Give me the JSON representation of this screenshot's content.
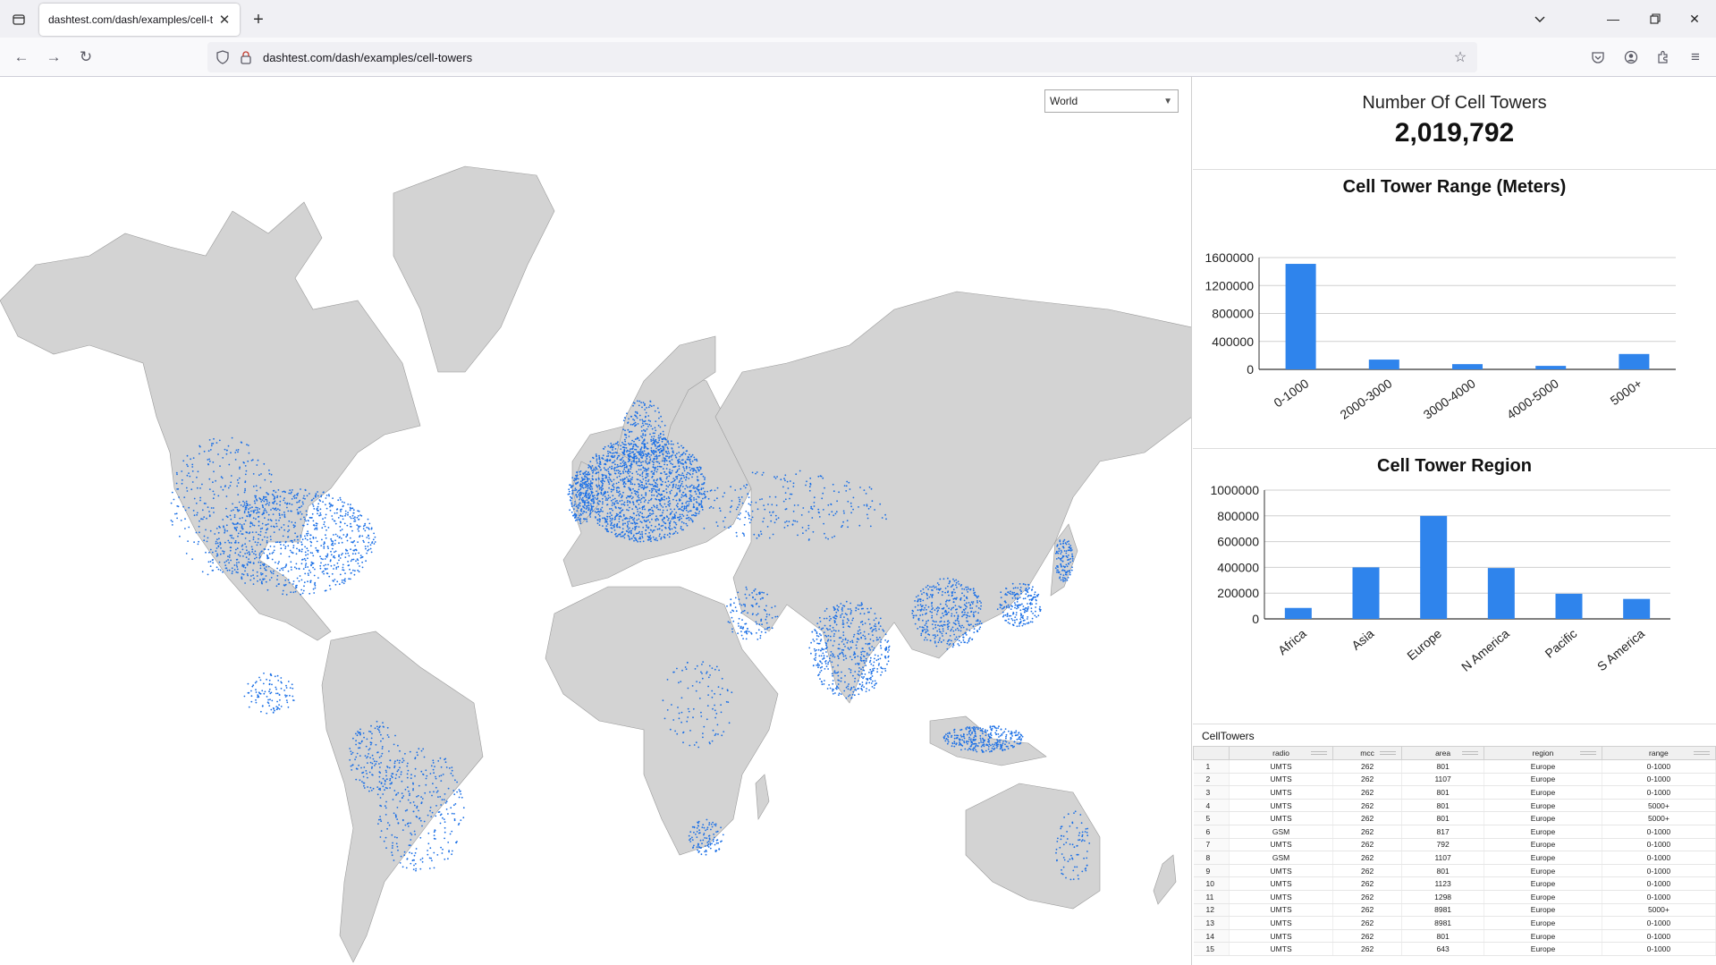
{
  "browser": {
    "tab_title": "dashtest.com/dash/examples/cell-t",
    "url": "dashtest.com/dash/examples/cell-towers"
  },
  "map": {
    "region_select": {
      "value": "World"
    },
    "land_color": "#d3d3d3",
    "tower_color": "#1a6fe6"
  },
  "summary": {
    "title": "Number Of Cell Towers",
    "value": "2,019,792"
  },
  "charts": [
    {
      "type": "bar",
      "title": "Cell Tower Range (Meters)",
      "categories": [
        "0-1000",
        "2000-3000",
        "3000-4000",
        "4000-5000",
        "5000+"
      ],
      "values": [
        1510000,
        140000,
        75000,
        50000,
        220000
      ],
      "ylim": [
        0,
        1600000
      ],
      "yticks": [
        "0",
        "400000",
        "800000",
        "1200000",
        "1600000"
      ],
      "color": "#2f84ec"
    },
    {
      "type": "bar",
      "title": "Cell Tower Region",
      "categories": [
        "Africa",
        "Asia",
        "Europe",
        "N America",
        "Pacific",
        "S America"
      ],
      "values": [
        85000,
        400000,
        800000,
        395000,
        195000,
        155000
      ],
      "ylim": [
        0,
        1000000
      ],
      "yticks": [
        "0",
        "200000",
        "400000",
        "600000",
        "800000",
        "1000000"
      ],
      "color": "#2f84ec"
    }
  ],
  "grid": {
    "title": "CellTowers",
    "columns": [
      "radio",
      "mcc",
      "area",
      "region",
      "range"
    ],
    "rows": [
      [
        "1",
        "UMTS",
        "262",
        "801",
        "Europe",
        "0-1000"
      ],
      [
        "2",
        "UMTS",
        "262",
        "1107",
        "Europe",
        "0-1000"
      ],
      [
        "3",
        "UMTS",
        "262",
        "801",
        "Europe",
        "0-1000"
      ],
      [
        "4",
        "UMTS",
        "262",
        "801",
        "Europe",
        "5000+"
      ],
      [
        "5",
        "UMTS",
        "262",
        "801",
        "Europe",
        "5000+"
      ],
      [
        "6",
        "GSM",
        "262",
        "817",
        "Europe",
        "0-1000"
      ],
      [
        "7",
        "UMTS",
        "262",
        "792",
        "Europe",
        "0-1000"
      ],
      [
        "8",
        "GSM",
        "262",
        "1107",
        "Europe",
        "0-1000"
      ],
      [
        "9",
        "UMTS",
        "262",
        "801",
        "Europe",
        "0-1000"
      ],
      [
        "10",
        "UMTS",
        "262",
        "1123",
        "Europe",
        "0-1000"
      ],
      [
        "11",
        "UMTS",
        "262",
        "1298",
        "Europe",
        "0-1000"
      ],
      [
        "12",
        "UMTS",
        "262",
        "8981",
        "Europe",
        "5000+"
      ],
      [
        "13",
        "UMTS",
        "262",
        "8981",
        "Europe",
        "0-1000"
      ],
      [
        "14",
        "UMTS",
        "262",
        "801",
        "Europe",
        "0-1000"
      ],
      [
        "15",
        "UMTS",
        "262",
        "643",
        "Europe",
        "0-1000"
      ]
    ]
  }
}
